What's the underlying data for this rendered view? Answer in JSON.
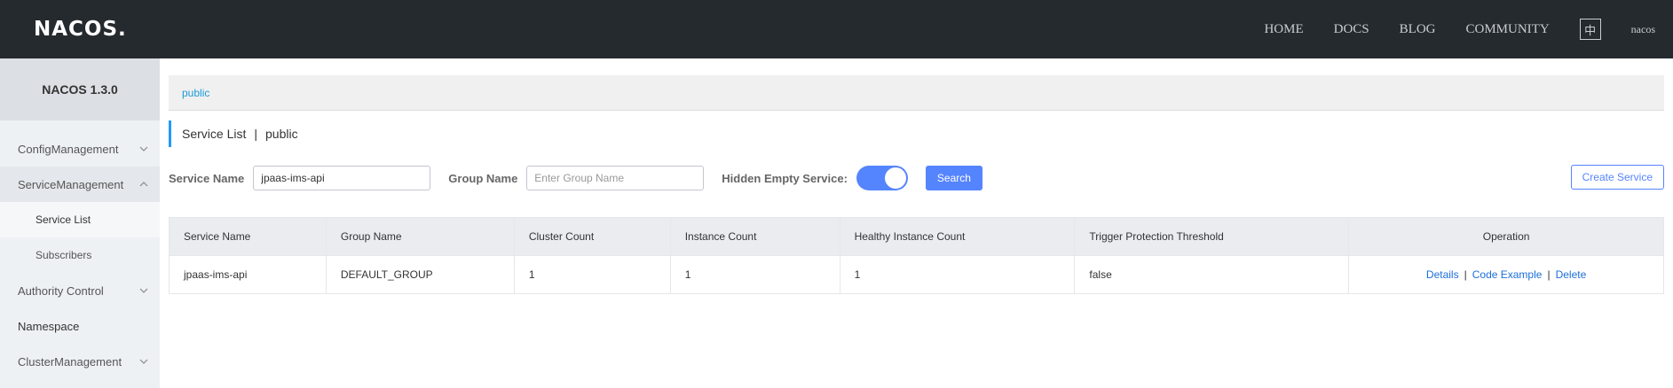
{
  "header": {
    "logo": "NACOS.",
    "nav": [
      "HOME",
      "DOCS",
      "BLOG",
      "COMMUNITY"
    ],
    "lang_label": "中",
    "user": "nacos"
  },
  "sidebar": {
    "title": "NACOS 1.3.0",
    "items": [
      {
        "label": "ConfigManagement"
      },
      {
        "label": "ServiceManagement"
      },
      {
        "label": "Service List"
      },
      {
        "label": "Subscribers"
      },
      {
        "label": "Authority Control"
      },
      {
        "label": "Namespace"
      },
      {
        "label": "ClusterManagement"
      }
    ]
  },
  "namespace_bar": {
    "link": "public"
  },
  "page_title": {
    "title": "Service List",
    "separator": "|",
    "namespace": "public"
  },
  "filters": {
    "service_name_label": "Service Name",
    "service_name_value": "jpaas-ims-api",
    "group_name_label": "Group Name",
    "group_name_placeholder": "Enter Group Name",
    "hidden_empty_label": "Hidden Empty Service:",
    "hidden_empty_on": true,
    "search_label": "Search",
    "create_label": "Create Service"
  },
  "table": {
    "headers": [
      "Service Name",
      "Group Name",
      "Cluster Count",
      "Instance Count",
      "Healthy Instance Count",
      "Trigger Protection Threshold",
      "Operation"
    ],
    "rows": [
      {
        "service": "jpaas-ims-api",
        "group": "DEFAULT_GROUP",
        "cluster": "1",
        "instance": "1",
        "healthy": "1",
        "threshold": "false"
      }
    ],
    "ops": {
      "details": "Details",
      "code_example": "Code Example",
      "delete": "Delete",
      "sep": "|"
    }
  },
  "colors": {
    "topbar": "#252a2f",
    "accent": "#5584ff",
    "link": "#1c6fd8"
  }
}
